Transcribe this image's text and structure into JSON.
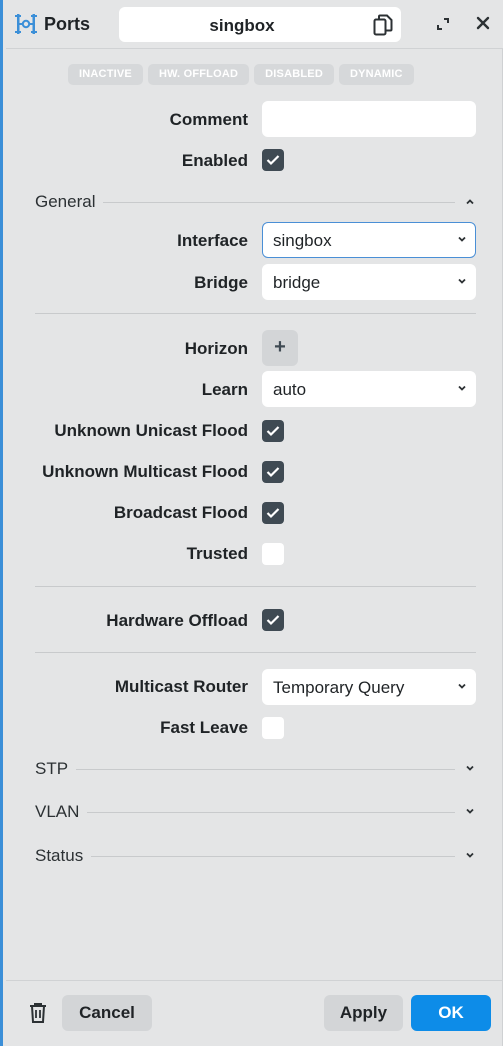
{
  "header": {
    "title": "Ports",
    "name": "singbox"
  },
  "badges": [
    "INACTIVE",
    "HW. OFFLOAD",
    "DISABLED",
    "DYNAMIC"
  ],
  "form": {
    "comment": {
      "label": "Comment",
      "value": ""
    },
    "enabled": {
      "label": "Enabled",
      "checked": true
    },
    "general_section": "General",
    "interface": {
      "label": "Interface",
      "value": "singbox"
    },
    "bridge": {
      "label": "Bridge",
      "value": "bridge"
    },
    "horizon": {
      "label": "Horizon",
      "button": "+"
    },
    "learn": {
      "label": "Learn",
      "value": "auto"
    },
    "unknown_unicast_flood": {
      "label": "Unknown Unicast Flood",
      "checked": true
    },
    "unknown_multicast_flood": {
      "label": "Unknown Multicast Flood",
      "checked": true
    },
    "broadcast_flood": {
      "label": "Broadcast Flood",
      "checked": true
    },
    "trusted": {
      "label": "Trusted",
      "checked": false
    },
    "hardware_offload": {
      "label": "Hardware Offload",
      "checked": true
    },
    "multicast_router": {
      "label": "Multicast Router",
      "value": "Temporary Query"
    },
    "fast_leave": {
      "label": "Fast Leave",
      "checked": false
    },
    "stp_section": "STP",
    "vlan_section": "VLAN",
    "status_section": "Status"
  },
  "footer": {
    "cancel": "Cancel",
    "apply": "Apply",
    "ok": "OK"
  },
  "colors": {
    "accent": "#0d8ce8",
    "checkbox_on": "#3f4a53",
    "background": "#e4e5e6"
  }
}
